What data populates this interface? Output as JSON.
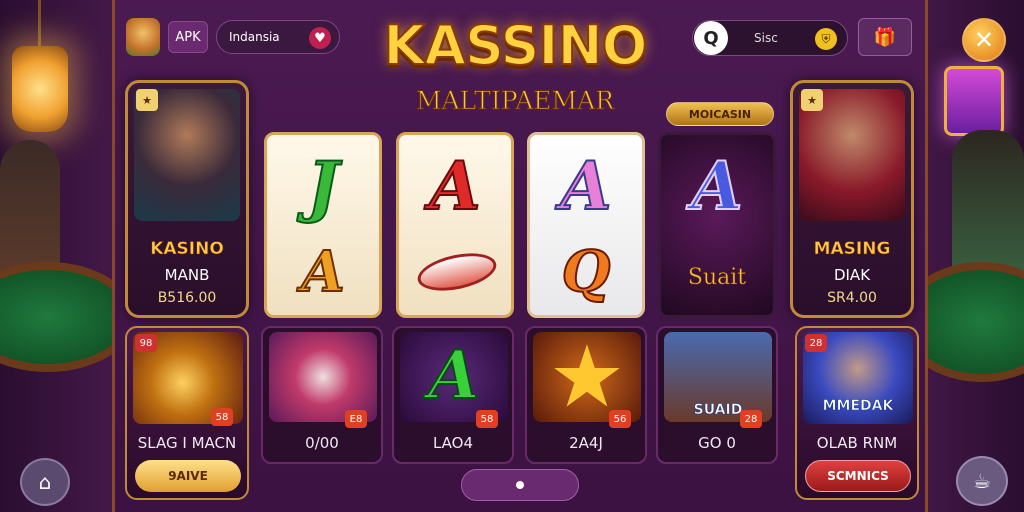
{
  "header": {
    "apk_label": "APK",
    "language": "Indansia",
    "title": "KASSINO",
    "subtitle": "MALTIPAEMAR",
    "search_text": "Sisc",
    "promo_badge": "MOICASIN"
  },
  "icons": {
    "logo": "mascot-logo-icon",
    "heart": "heart-icon",
    "search": "search-icon",
    "shield": "shield-icon",
    "gift": "gift-icon",
    "close": "close-icon",
    "home": "home-icon",
    "chat": "chat-icon"
  },
  "hero_left": {
    "corner": "★",
    "name": "KASINO",
    "sub": "MANB",
    "price": "B516.00"
  },
  "hero_right": {
    "corner": "★",
    "name": "MASING",
    "sub": "DIAK",
    "price": "SR4.00"
  },
  "tiles": [
    {
      "g1": "J",
      "g2": "A"
    },
    {
      "g1": "A",
      "g2": ""
    },
    {
      "g1": "A",
      "g2": "Q"
    },
    {
      "g1": "A",
      "label": "Suait"
    }
  ],
  "games": [
    {
      "name": "SLAG I MACN",
      "corner": "98",
      "badge": "58",
      "button": "9AIVE"
    },
    {
      "name": "0/00",
      "badge": "E8"
    },
    {
      "name": "LAO4",
      "badge": "58"
    },
    {
      "name": "2A4J",
      "badge": "56"
    },
    {
      "name": "GO 0",
      "badge": "28",
      "art_text": "SUAID"
    },
    {
      "name": "OLAB RNM",
      "corner": "28",
      "button": "SCMNICS",
      "art_text": "MMEDAK"
    }
  ],
  "colors": {
    "accent_gold": "#ffd23e",
    "panel_purple": "#4b1a52",
    "border_gold": "#c08a3a"
  }
}
